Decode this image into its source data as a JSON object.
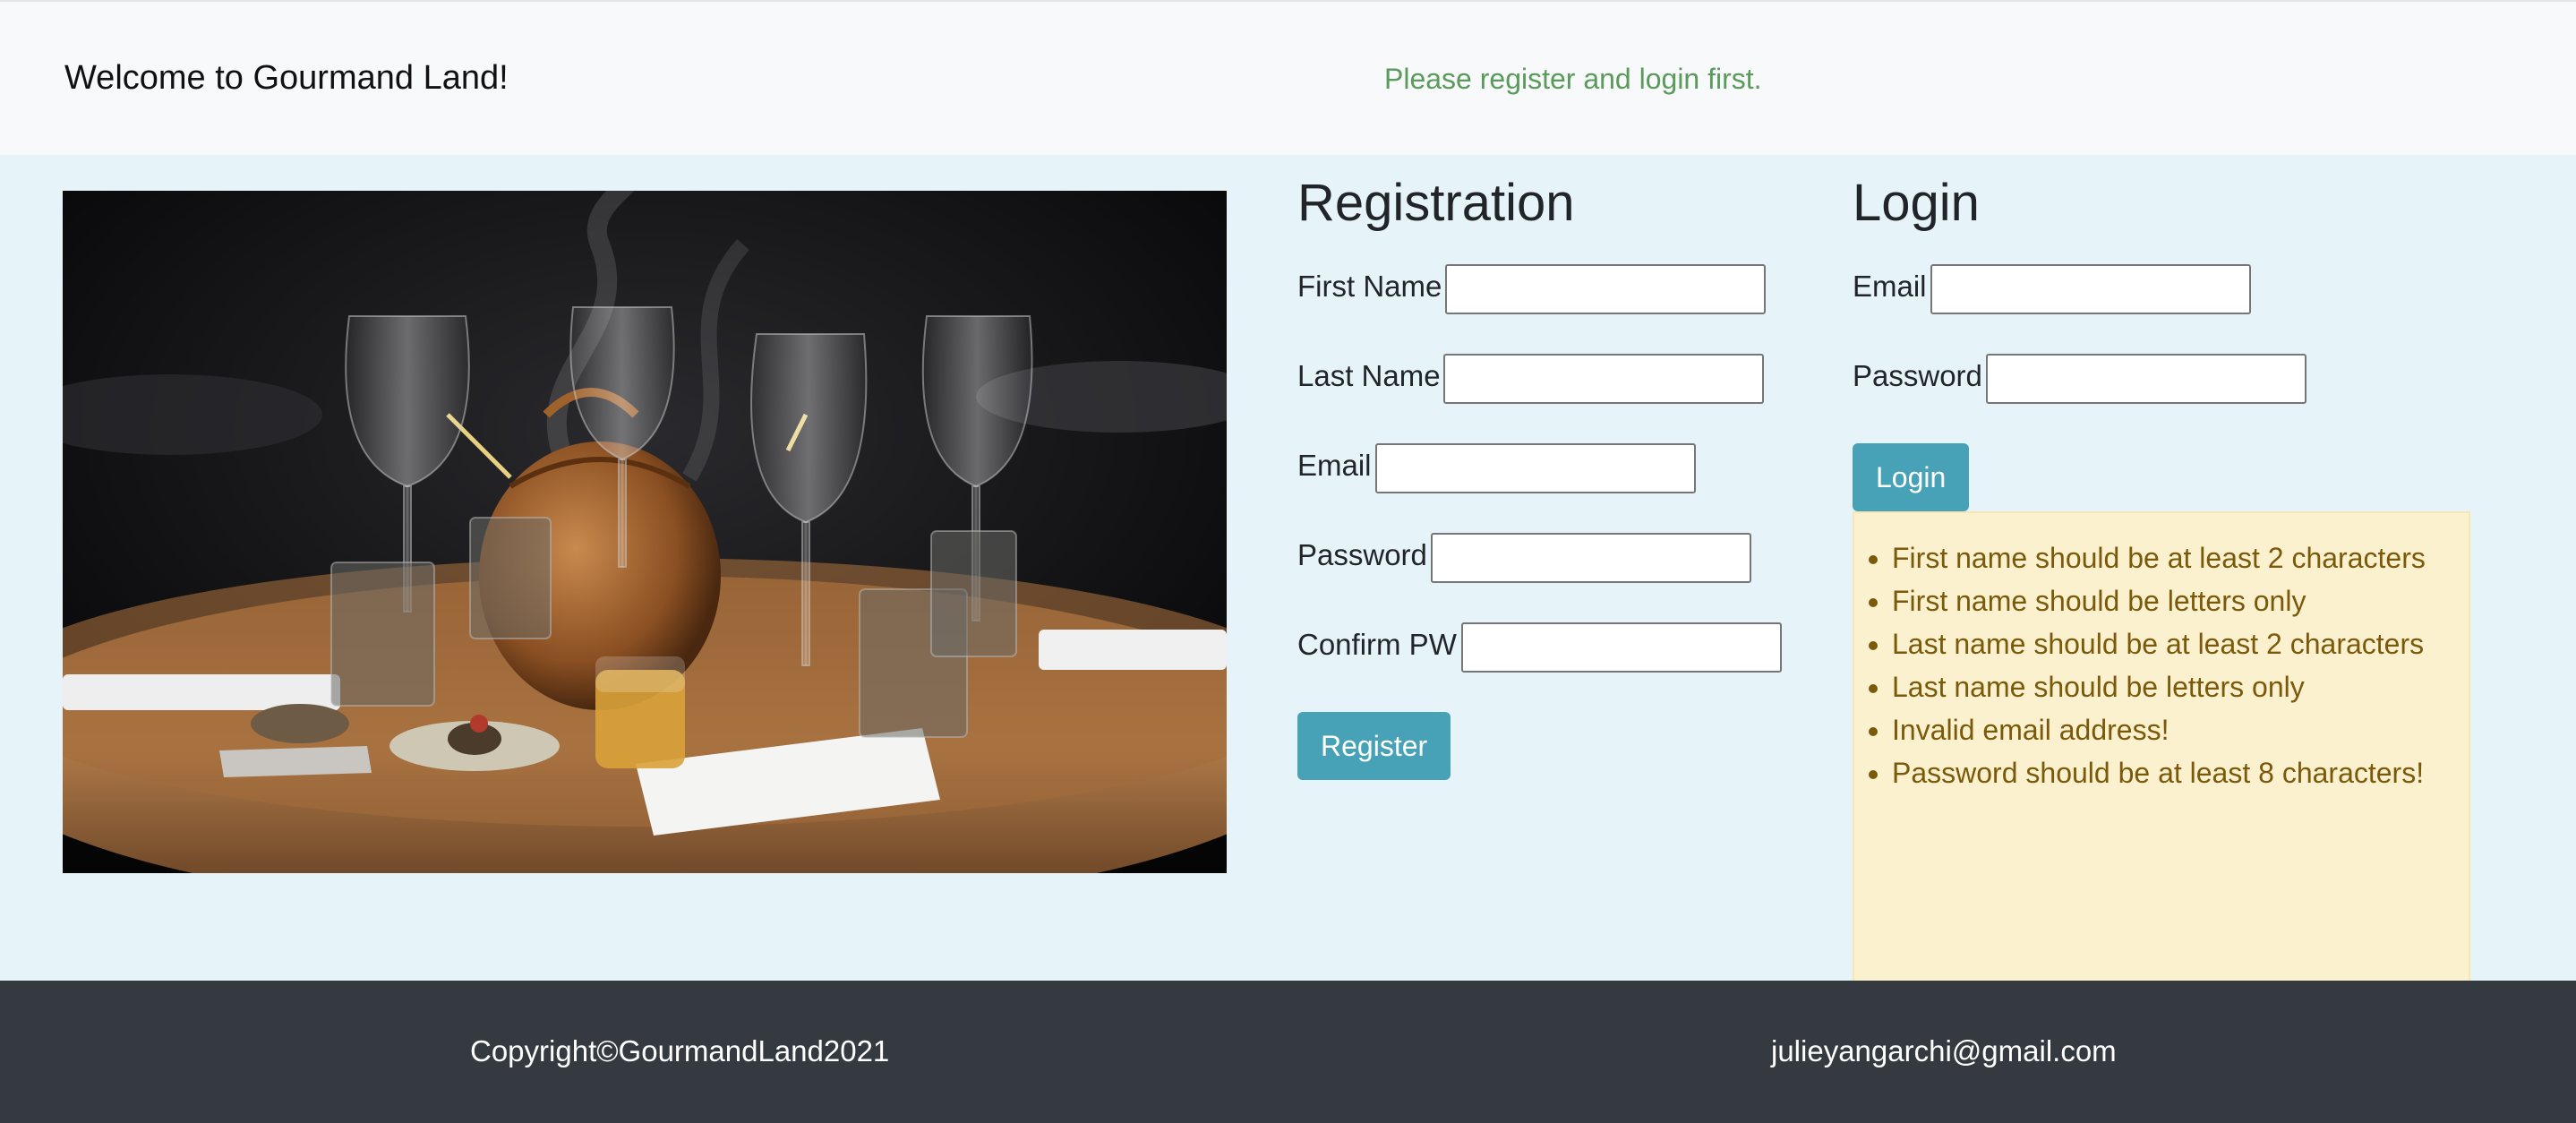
{
  "header": {
    "brand": "Welcome to Gourmand Land!",
    "notice": "Please register and login first."
  },
  "registration": {
    "title": "Registration",
    "first_name_label": "First Name",
    "last_name_label": "Last Name",
    "email_label": "Email",
    "password_label": "Password",
    "confirm_label": "Confirm PW",
    "first_name_value": "",
    "last_name_value": "",
    "email_value": "",
    "password_value": "",
    "confirm_value": "",
    "submit_label": "Register"
  },
  "login": {
    "title": "Login",
    "email_label": "Email",
    "password_label": "Password",
    "email_value": "",
    "password_value": "",
    "submit_label": "Login"
  },
  "errors": [
    "First name should be at least 2 characters",
    "First name should be letters only",
    "Last name should be at least 2 characters",
    "Last name should be letters only",
    "Invalid email address!",
    "Password should be at least 8 characters!"
  ],
  "footer": {
    "copyright": "Copyright©GourmandLand2021",
    "email": "julieyangarchi@gmail.com"
  },
  "colors": {
    "page_bg": "#e6f4fa",
    "button": "#47a2b8",
    "notice": "#5a9a5a",
    "alert_bg": "#fcf1cf",
    "footer_bg": "#343a40"
  }
}
